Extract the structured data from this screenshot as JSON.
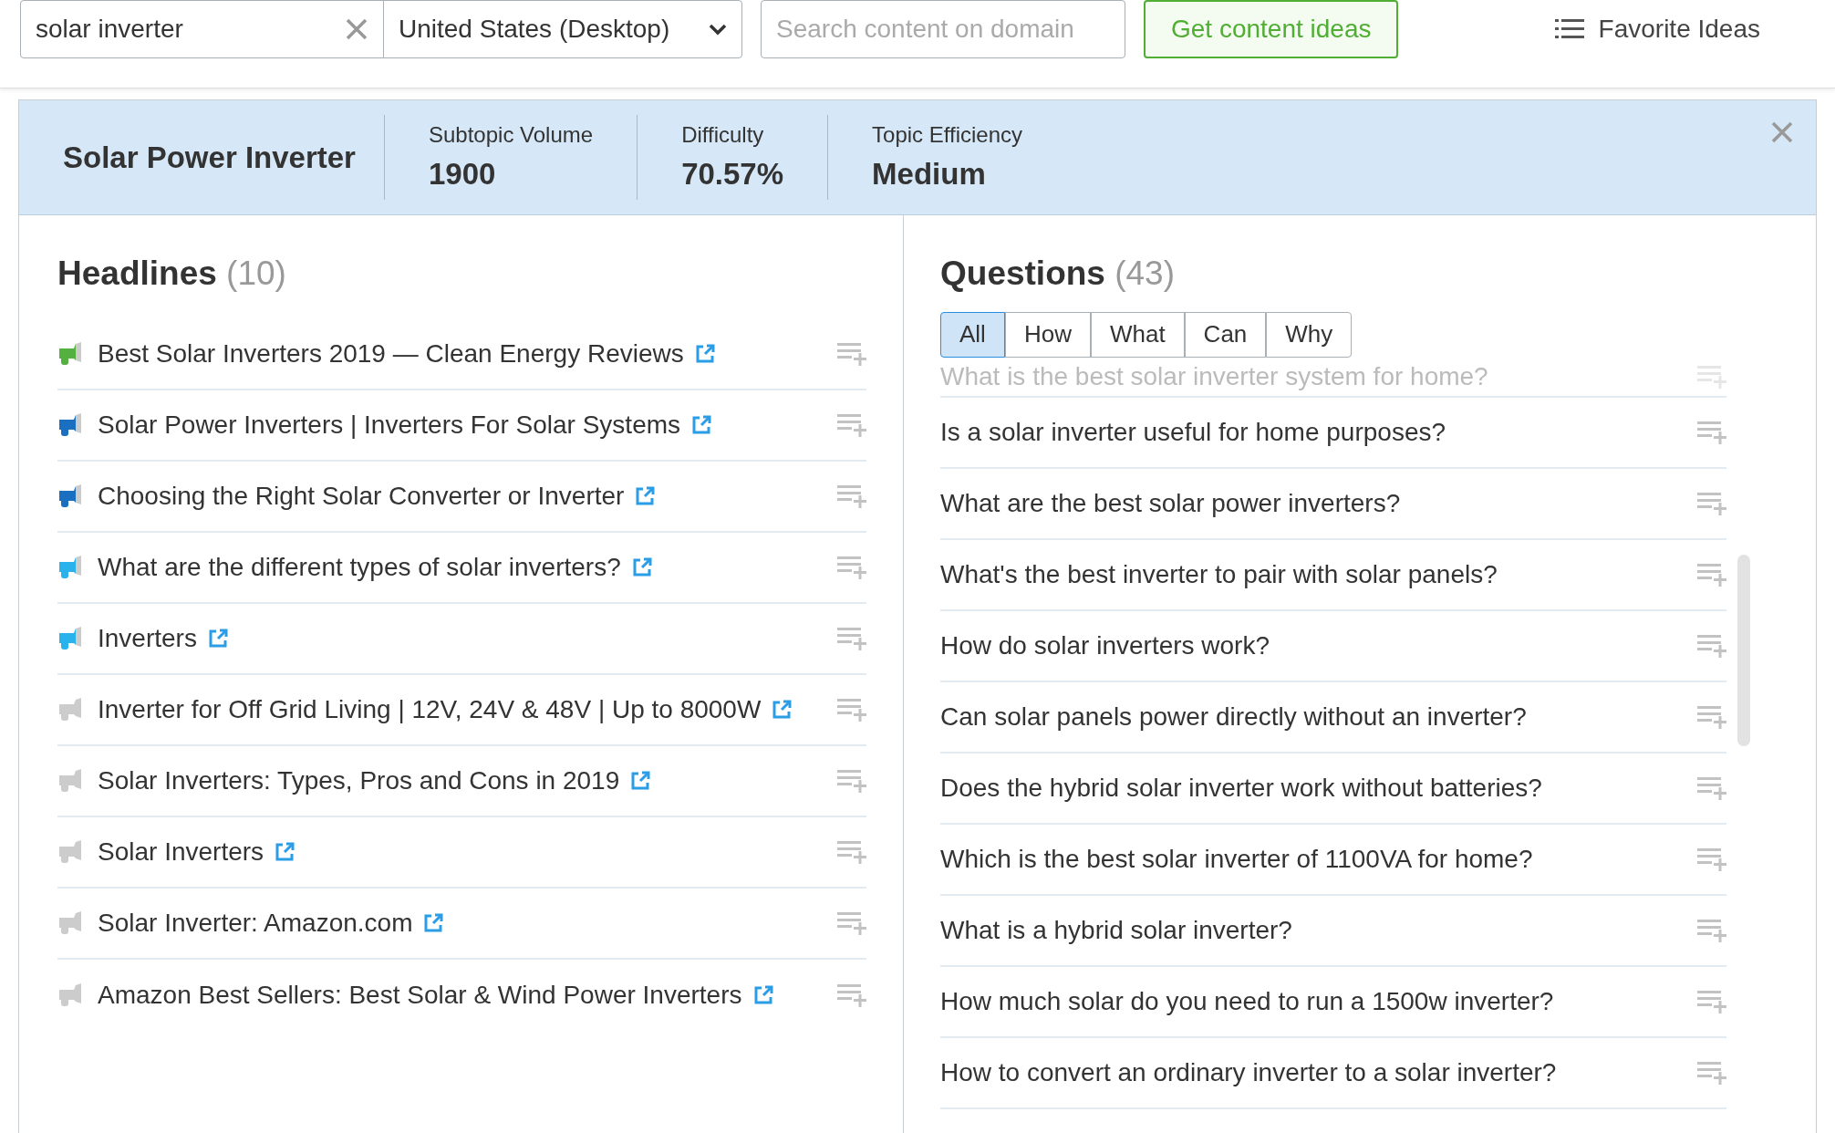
{
  "search": {
    "value": "solar inverter",
    "location": "United States (Desktop)",
    "domain_placeholder": "Search content on domain",
    "submit": "Get content ideas",
    "favorites": "Favorite Ideas"
  },
  "topic": {
    "title": "Solar Power Inverter",
    "stats": [
      {
        "label": "Subtopic Volume",
        "value": "1900"
      },
      {
        "label": "Difficulty",
        "value": "70.57%"
      },
      {
        "label": "Topic Efficiency",
        "value": "Medium"
      }
    ]
  },
  "headlines": {
    "title": "Headlines",
    "count": "(10)",
    "items": [
      {
        "text": "Best Solar Inverters 2019 — Clean Energy Reviews",
        "color": "#54b03f"
      },
      {
        "text": "Solar Power Inverters | Inverters For Solar Systems",
        "color": "#1a6fc1"
      },
      {
        "text": "Choosing the Right Solar Converter or Inverter",
        "color": "#1a6fc1"
      },
      {
        "text": "What are the different types of solar inverters?",
        "color": "#29b2eb"
      },
      {
        "text": "Inverters",
        "color": "#29b2eb"
      },
      {
        "text": "Inverter for Off Grid Living | 12V, 24V & 48V | Up to 8000W",
        "color": "#cccccc"
      },
      {
        "text": "Solar Inverters: Types, Pros and Cons in 2019",
        "color": "#cccccc"
      },
      {
        "text": "Solar Inverters",
        "color": "#cccccc"
      },
      {
        "text": "Solar Inverter: Amazon.com",
        "color": "#cccccc"
      },
      {
        "text": "Amazon Best Sellers: Best Solar & Wind Power Inverters",
        "color": "#cccccc"
      }
    ]
  },
  "questions": {
    "title": "Questions",
    "count": "(43)",
    "filters": [
      {
        "label": "All",
        "selected": true
      },
      {
        "label": "How",
        "selected": false
      },
      {
        "label": "What",
        "selected": false
      },
      {
        "label": "Can",
        "selected": false
      },
      {
        "label": "Why",
        "selected": false
      }
    ],
    "partial": "What is the best solar inverter system for home?",
    "items": [
      "Is a solar inverter useful for home purposes?",
      "What are the best solar power inverters?",
      "What's the best inverter to pair with solar panels?",
      "How do solar inverters work?",
      "Can solar panels power directly without an inverter?",
      "Does the hybrid solar inverter work without batteries?",
      "Which is the best solar inverter of 1100VA for home?",
      "What is a hybrid solar inverter?",
      "How much solar do you need to run a 1500w inverter?",
      "How to convert an ordinary inverter to a solar inverter?"
    ]
  }
}
